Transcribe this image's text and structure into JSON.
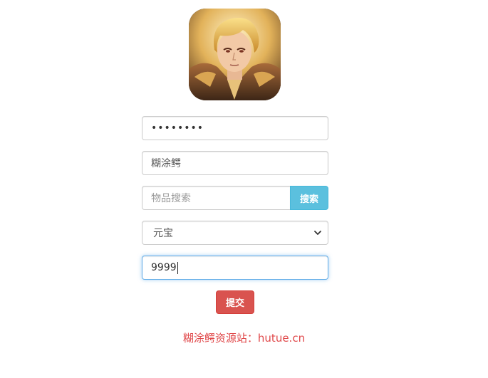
{
  "avatar": {
    "alt": "hero portrait"
  },
  "form": {
    "password_value": "••••••••",
    "name_value": "糊涂鳄",
    "search_placeholder": "物品搜索",
    "search_button": "搜索",
    "select_value": "元宝",
    "quantity_value": "9999",
    "submit_button": "提交"
  },
  "footer": {
    "text": "糊涂鳄资源站：hutue.cn"
  },
  "colors": {
    "search_button": "#5bc0de",
    "submit_button": "#d9534f",
    "footer_text": "#e0484a",
    "focus_border": "#66afe9"
  }
}
